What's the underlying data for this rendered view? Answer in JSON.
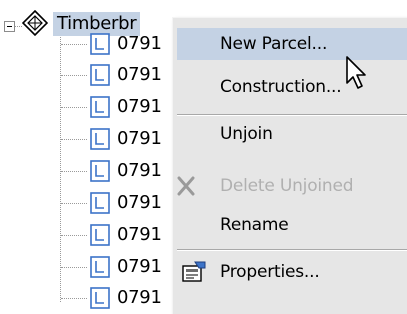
{
  "tree": {
    "root_label": "Timberbr",
    "children": [
      "0791",
      "0791",
      "0791",
      "0791",
      "0791",
      "0791",
      "0791",
      "0791",
      "0791"
    ]
  },
  "context_menu": {
    "items": {
      "new_parcel": "New Parcel...",
      "construction": "Construction...",
      "unjoin": "Unjoin",
      "delete_unjoined": "Delete Unjoined",
      "rename": "Rename",
      "properties": "Properties..."
    },
    "highlighted_item": "New Parcel...",
    "disabled_items": [
      "Delete Unjoined"
    ]
  },
  "icons": {
    "root": "diamond-sites-icon",
    "child": "parcel-icon",
    "delete": "delete-x-icon",
    "properties": "properties-icon",
    "cursor": "mouse-pointer-icon"
  },
  "colors": {
    "selection": "#c4d2e4",
    "menu_background": "#e6e6e6",
    "disabled_text": "#b0b0b0",
    "parcel_icon_blue": "#3c73c8"
  }
}
